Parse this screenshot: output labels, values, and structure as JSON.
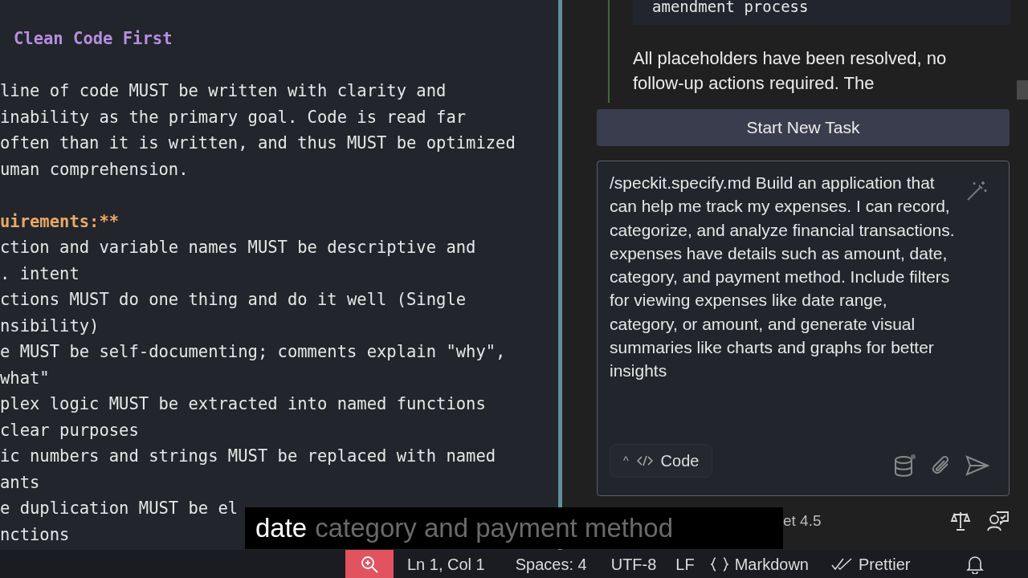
{
  "editor": {
    "lines": [
      {
        "kind": "heading",
        "text": "Clean Code First"
      },
      {
        "kind": "blank"
      },
      {
        "kind": "text",
        "text": "line of code MUST be written with clarity and"
      },
      {
        "kind": "text",
        "text": "inability as the primary goal. Code is read far"
      },
      {
        "kind": "text",
        "text": "often than it is written, and thus MUST be optimized"
      },
      {
        "kind": "text",
        "text": "uman comprehension."
      },
      {
        "kind": "blank"
      },
      {
        "kind": "emphasis",
        "text": "uirements:**"
      },
      {
        "kind": "text",
        "text": "ction and variable names MUST be descriptive and"
      },
      {
        "kind": "text",
        "text": ". intent"
      },
      {
        "kind": "text",
        "text": "ctions MUST do one thing and do it well (Single"
      },
      {
        "kind": "text",
        "text": "nsibility)"
      },
      {
        "kind": "text",
        "text": "e MUST be self-documenting; comments explain \"why\","
      },
      {
        "kind": "text",
        "text": "what\""
      },
      {
        "kind": "text",
        "text": "plex logic MUST be extracted into named functions"
      },
      {
        "kind": "text",
        "text": "clear purposes"
      },
      {
        "kind": "text",
        "text": "ic numbers and strings MUST be replaced with named"
      },
      {
        "kind": "text",
        "text": "ants"
      },
      {
        "kind": "text",
        "text": "e duplication MUST be el"
      },
      {
        "kind": "text",
        "text": "nctions"
      }
    ]
  },
  "chat": {
    "code_block": "amendment process",
    "message": "All placeholders have been resolved, no follow-up actions required. The",
    "start_button": "Start New Task",
    "prompt": "/speckit.specify.md Build an application that can help me track my expenses. I can record, categorize, and analyze financial transactions. expenses have details such as amount, date, category, and payment method. Include filters for viewing expenses like date range, category, or amount, and generate visual summaries like charts and graphs for better insights",
    "mode_caret": "^",
    "mode": "Code",
    "model": "et 4.5"
  },
  "status_bar": {
    "items": [
      "Ln 1, Col 1",
      "Spaces: 4",
      "UTF-8",
      "LF",
      "Markdown",
      "Prettier"
    ]
  },
  "caption": {
    "spoken": "date",
    "upcoming": "category and payment method"
  }
}
